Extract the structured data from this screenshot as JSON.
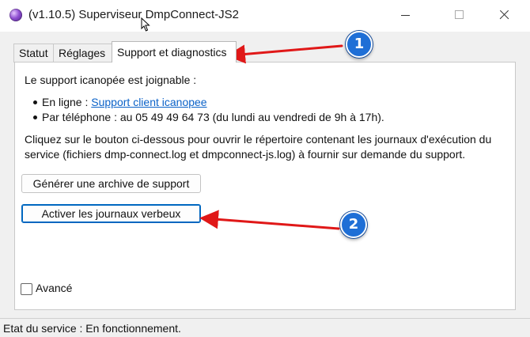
{
  "window": {
    "title": "(v1.10.5) Superviseur DmpConnect-JS2",
    "icon": "app-orb-icon"
  },
  "tabs": [
    {
      "label": "Statut",
      "active": false
    },
    {
      "label": "Réglages",
      "active": false
    },
    {
      "label": "Support et diagnostics",
      "active": true
    }
  ],
  "support": {
    "intro": "Le support icanopée est joignable :",
    "online_prefix": "En ligne : ",
    "online_link": "Support client icanopee",
    "phone": "Par téléphone : au 05 49 49 64 73 (du lundi au vendredi de 9h à 17h).",
    "instructions_line1": "Cliquez sur le bouton ci-dessous pour ouvrir le répertoire contenant les journaux d'exécution du",
    "instructions_line2": "service (fichiers dmp-connect.log et dmpconnect-js.log) à fournir sur demande du support.",
    "archive_button": "Générer une archive de support",
    "verbose_button": "Activer les journaux verbeux",
    "advanced_label": "Avancé",
    "advanced_checked": false
  },
  "statusbar": {
    "text": "Etat du service : En fonctionnement."
  },
  "annotations": {
    "badge_1": "1",
    "badge_2": "2",
    "color": "#e01818"
  }
}
